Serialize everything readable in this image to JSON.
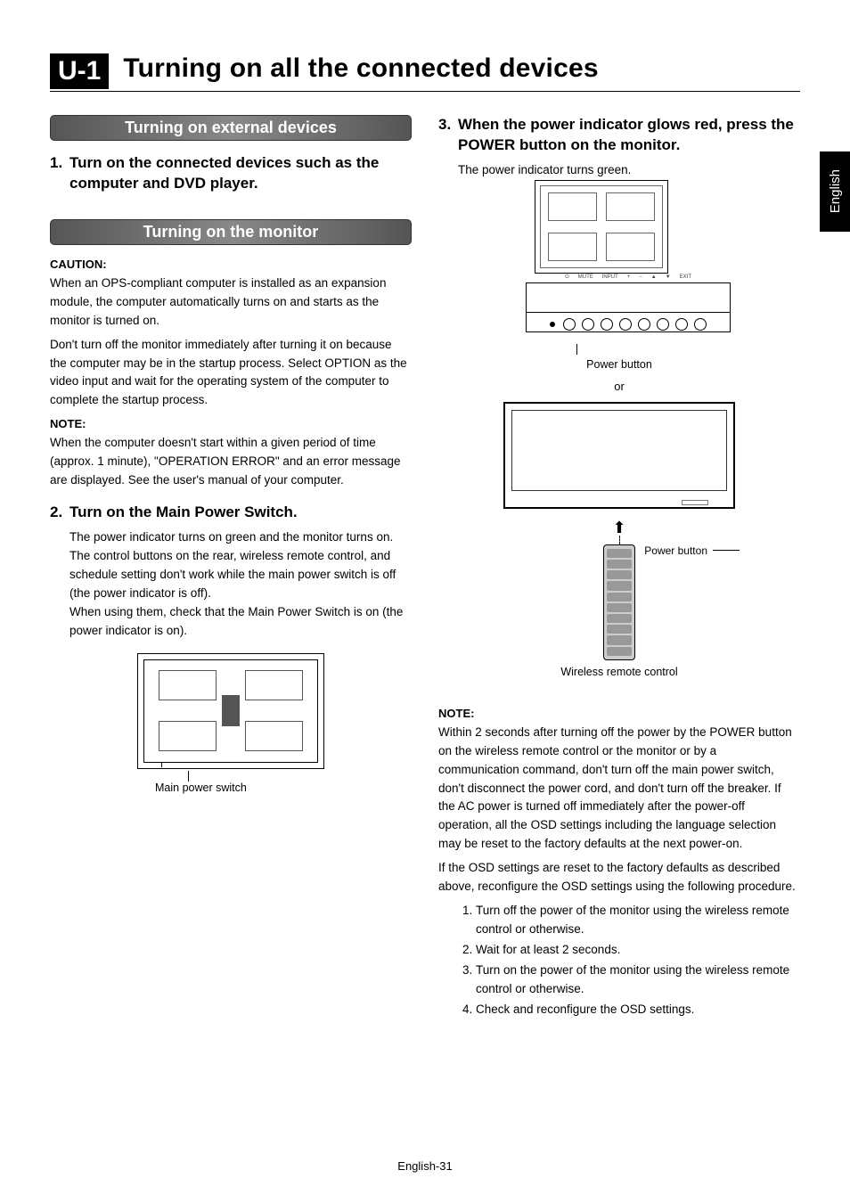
{
  "language_tab": "English",
  "chapter_code": "U-1",
  "chapter_title": "Turning on all the connected devices",
  "left": {
    "section1": {
      "header": "Turning on external devices",
      "step1": {
        "num": "1.",
        "title": "Turn on the connected devices such as the computer and DVD player."
      }
    },
    "section2": {
      "header": "Turning on the monitor",
      "caution_label": "CAUTION:",
      "caution_p1": "When an OPS-compliant computer is installed as an expansion module, the computer automatically turns on and starts as the monitor is turned on.",
      "caution_p2": "Don't turn off the monitor immediately after turning it on because the computer may be in the startup process. Select OPTION as the video input and wait for the operating system of the computer to complete the startup process.",
      "note_label": "NOTE:",
      "note_p": "When the computer doesn't start within a given period of time (approx. 1 minute), \"OPERATION ERROR\" and an error message are displayed. See the user's manual of your computer.",
      "step2": {
        "num": "2.",
        "title": "Turn on the Main Power Switch.",
        "p1": "The power indicator turns on green and the monitor turns on.",
        "p2": "The control buttons on the rear, wireless remote control, and schedule setting don't work while the main power switch is off (the power indicator is off).",
        "p3": "When using them, check that the Main Power Switch is on (the power indicator is on).",
        "diagram_leader": "Main power switch"
      }
    }
  },
  "right": {
    "step3": {
      "num": "3.",
      "title": "When the power indicator glows red, press the POWER button on the monitor.",
      "p1": "The power indicator turns green.",
      "diagram1_leader": "Power button",
      "or": "or",
      "diagram2_leader": "Power button",
      "remote_caption": "Wireless remote control"
    },
    "note": {
      "label": "NOTE:",
      "p1": "Within 2 seconds after turning off the power by the POWER button on the wireless remote control or the monitor or by a communication command, don't turn off the main power switch, don't disconnect the power cord, and don't turn off the breaker. If the AC power is turned off immediately after the power-off operation, all the OSD settings including the language selection may be reset to the factory defaults at the next power-on.",
      "p2": "If the OSD settings are reset to the factory defaults as described above, reconfigure the OSD settings using the following procedure.",
      "steps": [
        "Turn off the power of the monitor using the wireless remote control or otherwise.",
        "Wait for at least 2 seconds.",
        "Turn on the power of the monitor using the wireless remote control or otherwise.",
        "Check and reconfigure the OSD settings."
      ]
    }
  },
  "page_number": "English-31"
}
